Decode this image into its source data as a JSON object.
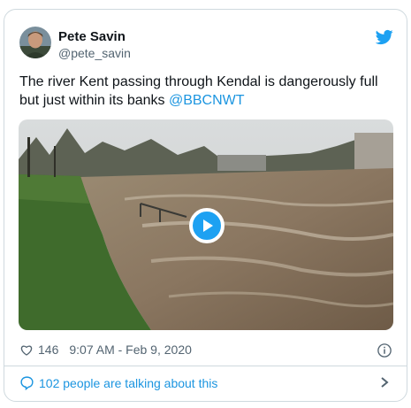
{
  "tweet": {
    "author_name": "Pete Savin",
    "author_handle": "@pete_savin",
    "text_main": "The river Kent passing through Kendal is dangerously full but just within its banks ",
    "mention": "@BBCNWT",
    "likes": "146",
    "timestamp": "9:07 AM - Feb 9, 2020",
    "talk_label": "102 people are talking about this"
  },
  "icons": {
    "avatar": "user-photo",
    "brand": "twitter-bird-icon",
    "like": "heart-icon",
    "info": "info-icon",
    "reply": "speech-bubble-icon",
    "more": "chevron-right-icon",
    "play": "play-icon"
  },
  "colors": {
    "link": "#1b95e0",
    "brand": "#1da1f2",
    "muted": "#536471",
    "border": "#cfd9de"
  }
}
